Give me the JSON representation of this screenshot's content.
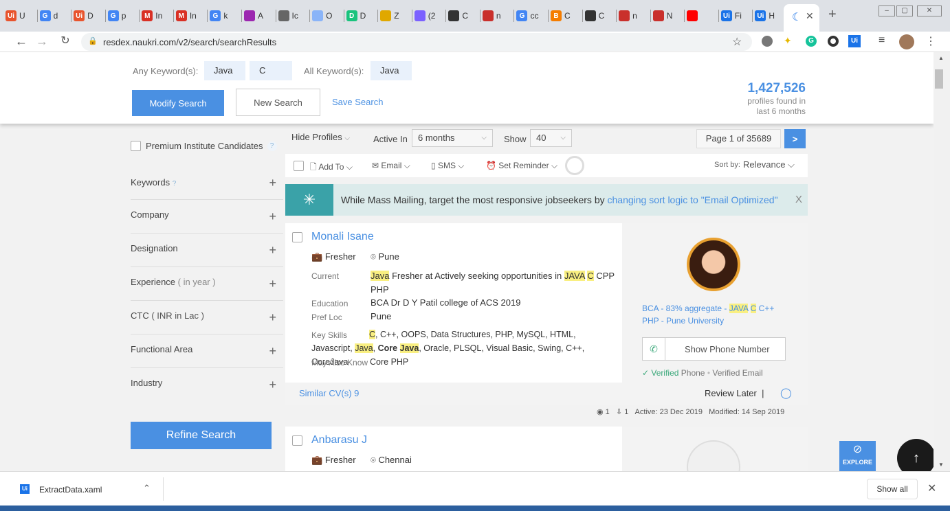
{
  "browser": {
    "tabs": [
      {
        "icon": "Ui",
        "label": "U",
        "color": "#e8542d"
      },
      {
        "icon": "G",
        "label": "d",
        "color": "#4285f4"
      },
      {
        "icon": "Ui",
        "label": "D",
        "color": "#e8542d"
      },
      {
        "icon": "G",
        "label": "p",
        "color": "#4285f4"
      },
      {
        "icon": "M",
        "label": "In",
        "color": "#d93025"
      },
      {
        "icon": "M",
        "label": "In",
        "color": "#d93025"
      },
      {
        "icon": "G",
        "label": "k",
        "color": "#4285f4"
      },
      {
        "icon": "",
        "label": "A",
        "color": "#9c27b0"
      },
      {
        "icon": "",
        "label": "Ic",
        "color": "#666666"
      },
      {
        "icon": "",
        "label": "O",
        "color": "#8ab4f8"
      },
      {
        "icon": "D",
        "label": "D",
        "color": "#19c37d"
      },
      {
        "icon": "",
        "label": "Z",
        "color": "#e0a800"
      },
      {
        "icon": "",
        "label": "(2",
        "color": "#7b61ff"
      },
      {
        "icon": "",
        "label": "C",
        "color": "#333333"
      },
      {
        "icon": "",
        "label": "n",
        "color": "#c9302c"
      },
      {
        "icon": "G",
        "label": "cc",
        "color": "#4285f4"
      },
      {
        "icon": "B",
        "label": "C",
        "color": "#f57d00"
      },
      {
        "icon": "",
        "label": "C",
        "color": "#333333"
      },
      {
        "icon": "",
        "label": "n",
        "color": "#c9302c"
      },
      {
        "icon": "",
        "label": "N",
        "color": "#c9302c"
      },
      {
        "icon": "",
        "label": "",
        "color": "#ff0000"
      },
      {
        "icon": "Ui",
        "label": "Fi",
        "color": "#1a73e8"
      },
      {
        "icon": "Ui",
        "label": "H",
        "color": "#1a73e8"
      }
    ],
    "url": "resdex.naukri.com/v2/search/searchResults",
    "new_tab_label": "+"
  },
  "search": {
    "any_keyword_label": "Any Keyword(s):",
    "any_keywords": [
      "Java",
      "C"
    ],
    "all_keyword_label": "All Keyword(s):",
    "all_keywords": [
      "Java"
    ],
    "modify_label": "Modify Search",
    "new_label": "New Search",
    "save_label": "Save Search",
    "count": "1,427,526",
    "count_sub1": "profiles found in",
    "count_sub2": "last 6 months"
  },
  "sidebar": {
    "premium_label": "Premium Institute Candidates",
    "help": "?",
    "facets": [
      {
        "label": "Keywords",
        "help": "?"
      },
      {
        "label": "Company",
        "help": ""
      },
      {
        "label": "Designation",
        "help": ""
      },
      {
        "label": "Experience",
        "suffix": "( in year )"
      },
      {
        "label": "CTC",
        "suffix": "( INR in Lac )"
      },
      {
        "label": "Functional Area",
        "help": ""
      },
      {
        "label": "Industry",
        "help": ""
      }
    ],
    "refine_label": "Refine Search"
  },
  "toolbar": {
    "hide_profiles": "Hide Profiles",
    "active_in_label": "Active In",
    "active_in_value": "6 months",
    "show_label": "Show",
    "show_value": "40",
    "page": "Page 1 of 35689",
    "next": ">",
    "add_to": "Add To",
    "email": "Email",
    "sms": "SMS",
    "set_reminder": "Set Reminder",
    "sort_by_label": "Sort by:",
    "sort_by_value": "Relevance"
  },
  "banner": {
    "text": "While Mass Mailing, target the most responsive jobseekers by",
    "link": "changing sort logic to \"Email Optimized\"",
    "close": "X"
  },
  "candidates": [
    {
      "name": "Monali Isane",
      "experience": "Fresher",
      "location": "Pune",
      "current_label": "Current",
      "education_label": "Education",
      "education": "BCA Dr D Y Patil college of ACS 2019",
      "pref_loc_label": "Pref Loc",
      "pref_loc": "Pune",
      "key_skills_label": "Key Skills",
      "may_know_label": "May Also Know",
      "may_know": "Core PHP",
      "degree_text": "PHP - Pune University",
      "show_phone": "Show Phone Number",
      "verified_phone": "Verified Phone",
      "verified_email": "Verified Email",
      "similar": "Similar CV(s) 9",
      "review_later": "Review Later",
      "views": "1",
      "downloads": "1",
      "active": "Active: 23 Dec 2019",
      "modified": "Modified: 14 Sep 2019"
    },
    {
      "name": "Anbarasu J",
      "experience": "Fresher",
      "location": "Chennai"
    }
  ],
  "widgets": {
    "explore": "EXPLORE",
    "to_top": "↑"
  },
  "downloads": {
    "file": "ExtractData.xaml",
    "show_all": "Show all"
  }
}
